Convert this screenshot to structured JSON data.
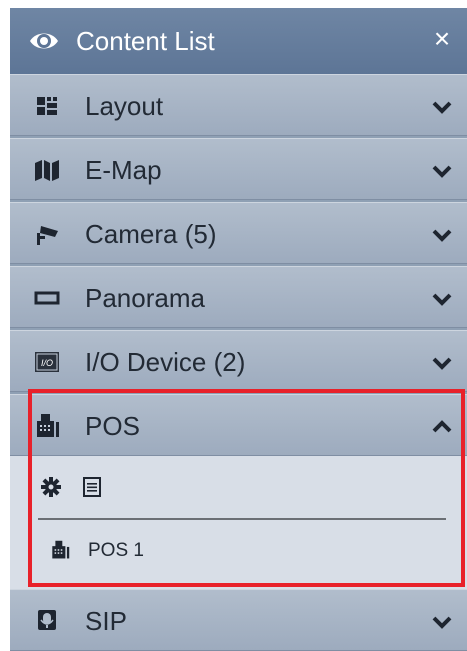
{
  "window": {
    "title": "Content List",
    "close_label": "×"
  },
  "rows": [
    {
      "label": "Layout",
      "icon": "layout-grid-icon"
    },
    {
      "label": "E-Map",
      "icon": "map-icon"
    },
    {
      "label": "Camera (5)",
      "icon": "camera-icon"
    },
    {
      "label": "Panorama",
      "icon": "panorama-icon"
    },
    {
      "label": "I/O Device (2)",
      "icon": "io-device-icon",
      "badge": "I/O"
    },
    {
      "label": "POS",
      "icon": "pos-icon",
      "expanded": true
    },
    {
      "label": "SIP",
      "icon": "sip-icon"
    }
  ],
  "pos_section": {
    "tools": [
      "gear-icon",
      "document-icon"
    ],
    "items": [
      {
        "label": "POS 1",
        "icon": "pos-icon"
      }
    ]
  },
  "colors": {
    "highlight": "#e8212a",
    "title_bar": "#5d7596"
  }
}
